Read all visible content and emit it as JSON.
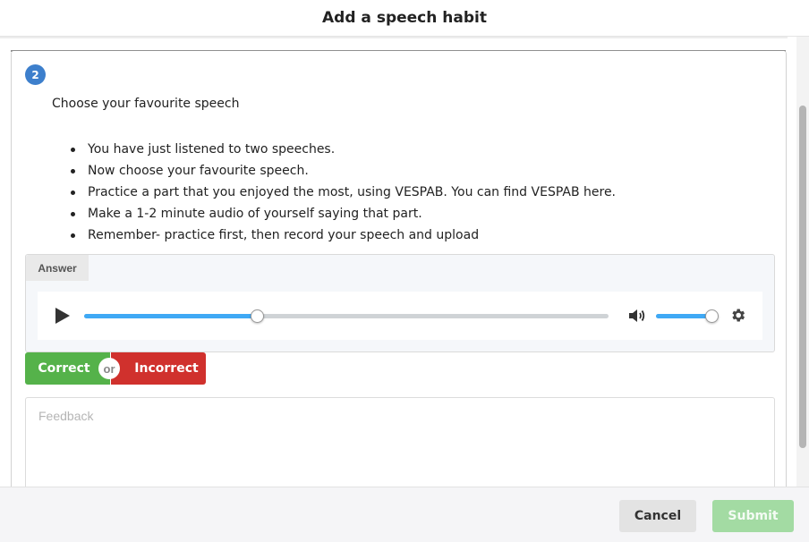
{
  "dialog": {
    "title": "Add a speech habit"
  },
  "task": {
    "step_number": "2",
    "title": "Choose your favourite speech",
    "bullets": [
      "You have just listened to two speeches.",
      "Now choose your favourite speech.",
      "Practice a part that you enjoyed the most, using VESPAB. You can find VESPAB here.",
      "Make a 1-2 minute audio of yourself saying that part.",
      "Remember- practice first, then record your speech and upload"
    ]
  },
  "answer": {
    "label": "Answer",
    "player": {
      "play_icon": "play-icon",
      "progress_fraction": 0.33,
      "volume_icon": "speaker-icon",
      "volume_fraction": 0.88,
      "settings_icon": "gear-icon"
    }
  },
  "grading": {
    "correct_label": "Correct",
    "or_label": "or",
    "incorrect_label": "Incorrect"
  },
  "feedback": {
    "placeholder": "Feedback",
    "value": ""
  },
  "footer": {
    "cancel_label": "Cancel",
    "submit_label": "Submit"
  },
  "colors": {
    "accent": "#3d7fcc",
    "progress": "#3fa9f5",
    "correct": "#55b24a",
    "incorrect": "#d0312d",
    "submit_disabled": "#a3dba3"
  }
}
